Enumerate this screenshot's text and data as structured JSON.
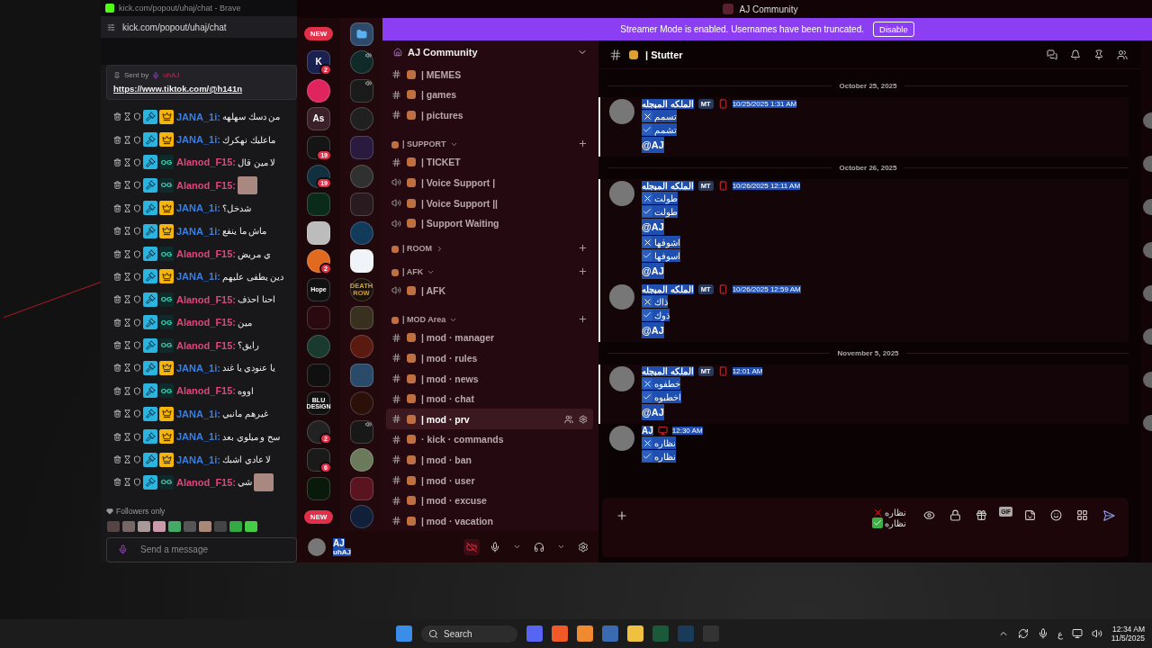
{
  "kick": {
    "window_title": "kick.com/popout/uhaj/chat - Brave",
    "url": "kick.com/popout/uhaj/chat",
    "pinned": {
      "label": "Sent by",
      "sender": "uhAJ",
      "link": "https://www.tiktok.com/@h141n"
    },
    "messages": [
      {
        "user": "JANA_1i:",
        "color": "#3a7ee0",
        "badge": {
          "kind": "vip"
        },
        "text": "من دسك سهلهه",
        "emote": false
      },
      {
        "user": "JANA_1i:",
        "color": "#3a7ee0",
        "badge": {
          "kind": "vip"
        },
        "text": "ماعليك نهكرك",
        "emote": false
      },
      {
        "user": "Alanod_F15:",
        "color": "#e0457b",
        "badge": {
          "kind": "og",
          "label": "OG"
        },
        "text": "لا مين قال",
        "emote": false
      },
      {
        "user": "Alanod_F15:",
        "color": "#e0457b",
        "badge": {
          "kind": "og",
          "label": "OG"
        },
        "emote": true
      },
      {
        "user": "JANA_1i:",
        "color": "#3a7ee0",
        "badge": {
          "kind": "vip"
        },
        "text": "شدخل؟",
        "emote": false
      },
      {
        "user": "JANA_1i:",
        "color": "#3a7ee0",
        "badge": {
          "kind": "vip"
        },
        "text": "ماش ما ينفع",
        "emote": false
      },
      {
        "user": "Alanod_F15:",
        "color": "#e0457b",
        "badge": {
          "kind": "og",
          "label": "OG"
        },
        "text": "ي مريض",
        "emote": false
      },
      {
        "user": "JANA_1i:",
        "color": "#3a7ee0",
        "badge": {
          "kind": "vip"
        },
        "text": "دين يطفى عليهم",
        "emote": false
      },
      {
        "user": "Alanod_F15:",
        "color": "#e0457b",
        "badge": {
          "kind": "og",
          "label": "OG"
        },
        "text": "احنا احذف",
        "emote": false
      },
      {
        "user": "Alanod_F15:",
        "color": "#e0457b",
        "badge": {
          "kind": "og",
          "label": "OG"
        },
        "text": "مين",
        "emote": false
      },
      {
        "user": "Alanod_F15:",
        "color": "#e0457b",
        "badge": {
          "kind": "og",
          "label": "OG"
        },
        "text": "رايق؟",
        "emote": false
      },
      {
        "user": "JANA_1i:",
        "color": "#3a7ee0",
        "badge": {
          "kind": "vip"
        },
        "text": "يا عنودي يا غند",
        "emote": false
      },
      {
        "user": "Alanod_F15:",
        "color": "#e0457b",
        "badge": {
          "kind": "og",
          "label": "OG"
        },
        "text": "اووه",
        "emote": false
      },
      {
        "user": "JANA_1i:",
        "color": "#3a7ee0",
        "badge": {
          "kind": "vip"
        },
        "text": "غيرهم مانبي",
        "emote": false
      },
      {
        "user": "JANA_1i:",
        "color": "#3a7ee0",
        "badge": {
          "kind": "vip"
        },
        "text": "سح و ميلوي بعد",
        "emote": false
      },
      {
        "user": "JANA_1i:",
        "color": "#3a7ee0",
        "badge": {
          "kind": "vip"
        },
        "text": "لا عادي اشبك",
        "emote": false
      },
      {
        "user": "Alanod_F15:",
        "color": "#e0457b",
        "badge": {
          "kind": "og",
          "label": "OG"
        },
        "text": "شي",
        "emote": true
      }
    ],
    "mode": "Followers only",
    "input": {
      "placeholder": "Send a message"
    }
  },
  "discord": {
    "title": "AJ Community",
    "banner": {
      "text": "Streamer Mode is enabled. Usernames have been truncated.",
      "button": "Disable"
    },
    "rail": [
      {
        "pill": "NEW"
      },
      {
        "color": "#1a2050",
        "label": "K",
        "badge": "2"
      },
      {
        "color": "#e0245e"
      },
      {
        "color": "#3a2028",
        "label": "As"
      },
      {
        "color": "#151515",
        "badge": "19"
      },
      {
        "color": "#103040",
        "badge": "19"
      },
      {
        "color": "#0a2a1a"
      },
      {
        "color": "#bcbcbc"
      },
      {
        "color": "#e06a20",
        "badge": "2"
      },
      {
        "color": "#111111",
        "label": "Hope"
      },
      {
        "color": "#2a0a0e"
      },
      {
        "color": "#1a3a30"
      },
      {
        "color": "#101010"
      },
      {
        "color": "#111111",
        "label": "BLU DESIGN"
      },
      {
        "color": "#222222",
        "badge": "2"
      },
      {
        "color": "#1a1a1a",
        "badge": "6"
      },
      {
        "color": "#0a1a0a"
      },
      {
        "pill": "NEW"
      }
    ],
    "rail2": [
      {
        "kind": "folder",
        "color": "#2d4a6a"
      },
      {
        "kind": "server",
        "color": "#102a2a",
        "speaking": true
      },
      {
        "kind": "server",
        "color": "#1a1a1a",
        "speaking": true
      },
      {
        "kind": "server",
        "color": "#202020",
        "speaking": false
      },
      {
        "kind": "server",
        "color": "#2a1a40",
        "speaking": false
      },
      {
        "kind": "server",
        "color": "#303030",
        "speaking": false
      },
      {
        "kind": "server",
        "color": "#281a1e",
        "speaking": false
      },
      {
        "kind": "server",
        "color": "#123a5a",
        "speaking": false
      },
      {
        "kind": "server",
        "color": "#f0f4f8",
        "speaking": false
      },
      {
        "kind": "server",
        "color": "#1a1208",
        "label": "DEATH ROW",
        "speaking": false
      },
      {
        "kind": "server",
        "color": "#3a3020",
        "speaking": false
      },
      {
        "kind": "server",
        "color": "#5a1a10",
        "speaking": false
      },
      {
        "kind": "server",
        "color": "#2a4a6a",
        "speaking": false
      },
      {
        "kind": "server",
        "color": "#2a1008",
        "speaking": false
      },
      {
        "kind": "server",
        "color": "#181818",
        "speaking": true
      },
      {
        "kind": "server",
        "color": "#6a7a5a",
        "speaking": false
      },
      {
        "kind": "server",
        "color": "#5a1420",
        "speaking": false
      },
      {
        "kind": "server",
        "color": "#10203a",
        "speaking": false
      }
    ],
    "server": {
      "name": "AJ Community"
    },
    "channels": [
      {
        "kind": "text",
        "name": "| MEMES",
        "selected": false
      },
      {
        "kind": "text",
        "name": "| games",
        "selected": false
      },
      {
        "kind": "text",
        "name": "| pictures",
        "selected": false
      },
      {
        "kind": "category",
        "name": "| SUPPORT",
        "expanded": true
      },
      {
        "kind": "text",
        "name": "| TICKET",
        "selected": false
      },
      {
        "kind": "voice",
        "name": "| Voice Support |",
        "selected": false
      },
      {
        "kind": "voice",
        "name": "| Voice Support ||",
        "selected": false
      },
      {
        "kind": "voice",
        "name": "| Support Waiting",
        "selected": false
      },
      {
        "kind": "category",
        "name": "| ROOM",
        "expanded": false
      },
      {
        "kind": "category",
        "name": "| AFK",
        "expanded": true
      },
      {
        "kind": "voice",
        "name": "| AFK",
        "selected": false
      },
      {
        "kind": "category",
        "name": "| MOD Area",
        "expanded": true
      },
      {
        "kind": "locked",
        "name": "| mod · manager",
        "selected": false
      },
      {
        "kind": "locked",
        "name": "| mod · rules",
        "selected": false
      },
      {
        "kind": "locked",
        "name": "| mod · news",
        "selected": false
      },
      {
        "kind": "locked",
        "name": "| mod · chat",
        "selected": false
      },
      {
        "kind": "locked",
        "name": "| mod · prv",
        "selected": true
      },
      {
        "kind": "locked",
        "name": "· kick · commands",
        "selected": false
      },
      {
        "kind": "locked",
        "name": "| mod · ban",
        "selected": false
      },
      {
        "kind": "locked",
        "name": "| mod · user",
        "selected": false
      },
      {
        "kind": "locked",
        "name": "| mod · excuse",
        "selected": false
      },
      {
        "kind": "locked",
        "name": "| mod · vacation",
        "selected": false
      }
    ],
    "user": {
      "name": "AJ",
      "tag": "uhAJ"
    },
    "chat": {
      "channel": "| Stutter",
      "items": [
        {
          "kind": "date",
          "text": "October 25, 2025"
        },
        {
          "kind": "message",
          "author": "الملكه المبجله",
          "tag": "MT",
          "mobile": true,
          "time": "10/25/2025 1:31 AM",
          "lines": [
            {
              "kind": "cross",
              "text": "تسمم"
            },
            {
              "kind": "check",
              "text": "تشمم"
            },
            {
              "kind": "mention",
              "text": "@AJ"
            }
          ]
        },
        {
          "kind": "date",
          "text": "October 26, 2025"
        },
        {
          "kind": "message",
          "author": "الملكه المبجله",
          "tag": "MT",
          "mobile": true,
          "time": "10/26/2025 12:11 AM",
          "lines": [
            {
              "kind": "cross",
              "text": "طولت"
            },
            {
              "kind": "check",
              "text": "طولت"
            },
            {
              "kind": "mention",
              "text": "@AJ"
            },
            {
              "kind": "cross",
              "text": "اشوفها"
            },
            {
              "kind": "check",
              "text": "اسوفها"
            },
            {
              "kind": "mention",
              "text": "@AJ"
            }
          ]
        },
        {
          "kind": "message",
          "author": "الملكه المبجله",
          "tag": "MT",
          "mobile": true,
          "time": "10/26/2025 12:59 AM",
          "lines": [
            {
              "kind": "cross",
              "text": "ذاك"
            },
            {
              "kind": "check",
              "text": "ذوك"
            },
            {
              "kind": "mention",
              "text": "@AJ"
            }
          ]
        },
        {
          "kind": "date",
          "text": "November 5, 2025"
        },
        {
          "kind": "message",
          "author": "الملكه المبجله",
          "tag": "MT",
          "mobile": true,
          "time": "12:01 AM",
          "lines": [
            {
              "kind": "cross",
              "text": "خطفوه"
            },
            {
              "kind": "check",
              "text": "اخطبوه"
            },
            {
              "kind": "mention",
              "text": "@AJ"
            }
          ]
        },
        {
          "kind": "message",
          "author": "AJ",
          "mobile": false,
          "time": "12:30 AM",
          "lines": [
            {
              "kind": "cross",
              "text": "نظاره"
            },
            {
              "kind": "check",
              "text": "نظاره"
            }
          ]
        }
      ],
      "composer": {
        "lines": [
          {
            "kind": "cross",
            "text": "نظاره"
          },
          {
            "kind": "check",
            "text": "نظاره"
          }
        ],
        "gif": "GIF"
      }
    }
  },
  "taskbar": {
    "search": "Search",
    "language": "ع",
    "time": "12:34 AM",
    "date": "11/5/2025"
  }
}
